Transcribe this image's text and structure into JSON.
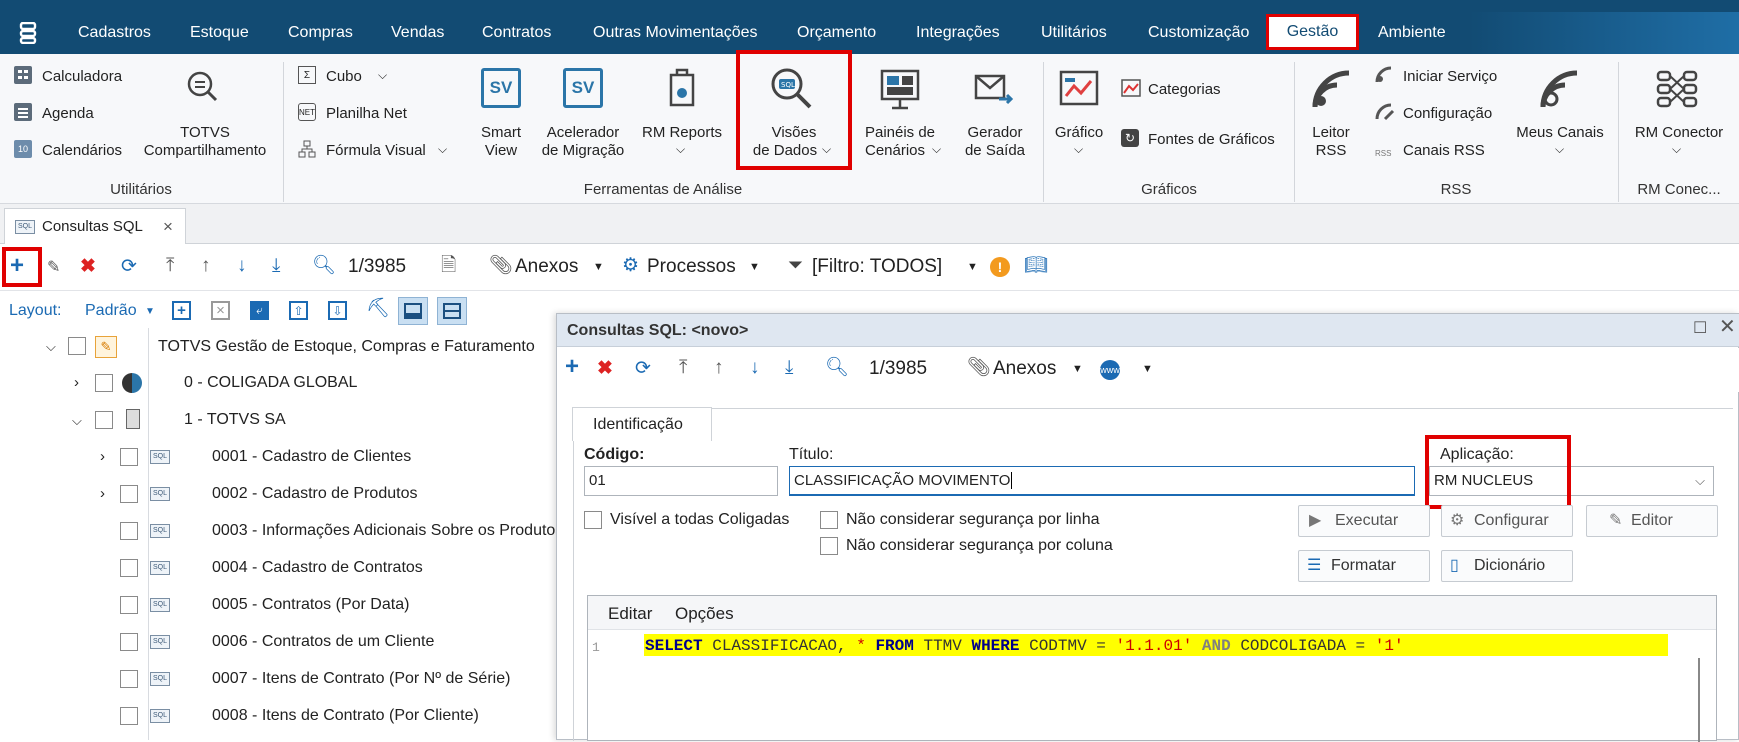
{
  "menu": {
    "items": [
      "Cadastros",
      "Estoque",
      "Compras",
      "Vendas",
      "Contratos",
      "Outras Movimentações",
      "Orçamento",
      "Integrações",
      "Utilitários",
      "Customização",
      "Gestão",
      "Ambiente"
    ]
  },
  "ribbon": {
    "utilitarios": {
      "calculadora": "Calculadora",
      "agenda": "Agenda",
      "calendarios": "Calendários",
      "totvs_line1": "TOTVS",
      "totvs_line2": "Compartilhamento",
      "group": "Utilitários"
    },
    "analise": {
      "cubo": "Cubo",
      "planilha": "Planilha Net",
      "formula": "Fórmula Visual",
      "smart1": "Smart",
      "smart2": "View",
      "acel1": "Acelerador",
      "acel2": "de Migração",
      "rmreports": "RM Reports",
      "visoes1": "Visões",
      "visoes2": "de Dados",
      "paineis1": "Painéis de",
      "paineis2": "Cenários",
      "gerador1": "Gerador",
      "gerador2": "de Saída",
      "group": "Ferramentas de Análise"
    },
    "graficos": {
      "grafico": "Gráfico",
      "categorias": "Categorias",
      "fontes": "Fontes de Gráficos",
      "group": "Gráficos"
    },
    "rss": {
      "leitor1": "Leitor",
      "leitor2": "RSS",
      "iniciar": "Iniciar Serviço",
      "config": "Configuração",
      "canais": "Canais RSS",
      "meus": "Meus Canais",
      "group": "RSS"
    },
    "rmcon": {
      "conector": "RM Conector",
      "group": "RM Conec..."
    }
  },
  "tab": {
    "label": "Consultas SQL",
    "close": "×"
  },
  "toolbar": {
    "counter": "1/3985",
    "anexos": "Anexos",
    "processos": "Processos",
    "filtro": "[Filtro: TODOS]"
  },
  "layout": {
    "label": "Layout:",
    "value": "Padrão"
  },
  "tree": {
    "root": "TOTVS Gestão de Estoque, Compras e Faturamento",
    "c0": "0 - COLIGADA GLOBAL",
    "c1": "1 - TOTVS SA",
    "items": [
      "0001 - Cadastro de Clientes",
      "0002 - Cadastro de Produtos",
      "0003 - Informações Adicionais Sobre os Produtos",
      "0004 - Cadastro de Contratos",
      "0005 - Contratos (Por Data)",
      "0006 - Contratos de um Cliente",
      "0007 - Itens de Contrato (Por  Nº de Série)",
      "0008 - Itens de Contrato (Por Cliente)"
    ]
  },
  "dialog": {
    "title": "Consultas SQL: <novo>",
    "counter": "1/3985",
    "anexos": "Anexos",
    "tab": "Identificação",
    "codigo_label": "Código:",
    "codigo_value": "01",
    "titulo_label": "Título:",
    "titulo_value": "CLASSIFICAÇÃO MOVIMENTO",
    "aplicacao_label": "Aplicação:",
    "aplicacao_value": "RM NUCLEUS",
    "visivel": "Visível a todas Coligadas",
    "seg_linha": "Não considerar segurança por linha",
    "seg_coluna": "Não considerar segurança por coluna",
    "executar": "Executar",
    "configurar": "Configurar",
    "editor": "Editor",
    "formatar": "Formatar",
    "dicionario": "Dicionário",
    "menu_editar": "Editar",
    "menu_opcoes": "Opções",
    "line_no": "1",
    "sql": {
      "kw1": "SELECT",
      "t1": " CLASSIFICACAO, ",
      "star": "*",
      "kw2": " FROM",
      "t2": " TTMV ",
      "kw3": "WHERE",
      "t3": " CODTMV = ",
      "s1": "'1.1.01'",
      "kw4": " AND",
      "t4": " CODCOLIGADA = ",
      "s2": "'1'"
    }
  },
  "colors": {
    "menubar": "#124b73",
    "highlight_red": "#e00000",
    "sql_highlight": "#ffff00"
  }
}
